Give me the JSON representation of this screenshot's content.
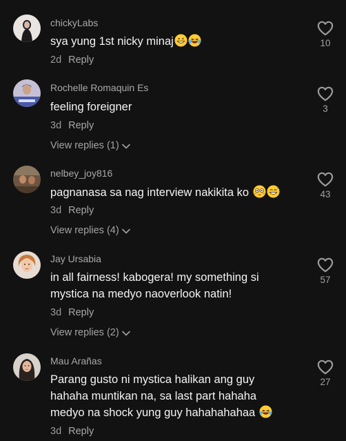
{
  "comments": [
    {
      "username": "chickyLabs",
      "text": "sya yung 1st nicky minaj",
      "emojis": [
        "grinning-face-emoji",
        "laughing-tears-emoji"
      ],
      "time": "2d",
      "reply_label": "Reply",
      "likes": "10",
      "view_replies": ""
    },
    {
      "username": "Rochelle Romaquin Es",
      "text": "feeling foreigner",
      "emojis": [],
      "time": "3d",
      "reply_label": "Reply",
      "likes": "3",
      "view_replies": "View replies (1)"
    },
    {
      "username": "nelbey_joy816",
      "text": "pagnanasa sa nag interview nakikita ko",
      "emojis": [
        "flushed-face-emoji",
        "sweat-smile-emoji"
      ],
      "time": "3d",
      "reply_label": "Reply",
      "likes": "43",
      "view_replies": "View replies (4)"
    },
    {
      "username": "Jay Ursabia",
      "text": "in all fairness! kabogera! my something si mystica na medyo naoverlook natin!",
      "emojis": [],
      "time": "3d",
      "reply_label": "Reply",
      "likes": "57",
      "view_replies": "View replies (2)"
    },
    {
      "username": "Mau Arañas",
      "text": "Parang gusto ni mystica halikan ang guy hahaha muntikan na, sa last part hahaha medyo na shock yung guy hahahahahaa",
      "emojis": [
        "laughing-tears-emoji"
      ],
      "time": "3d",
      "reply_label": "Reply",
      "likes": "27",
      "view_replies": ""
    }
  ],
  "colors": {
    "background": "#121212",
    "text": "#f4f4f4",
    "secondary": "#a9a9a9",
    "emoji_yellow": "#ffcc33"
  }
}
